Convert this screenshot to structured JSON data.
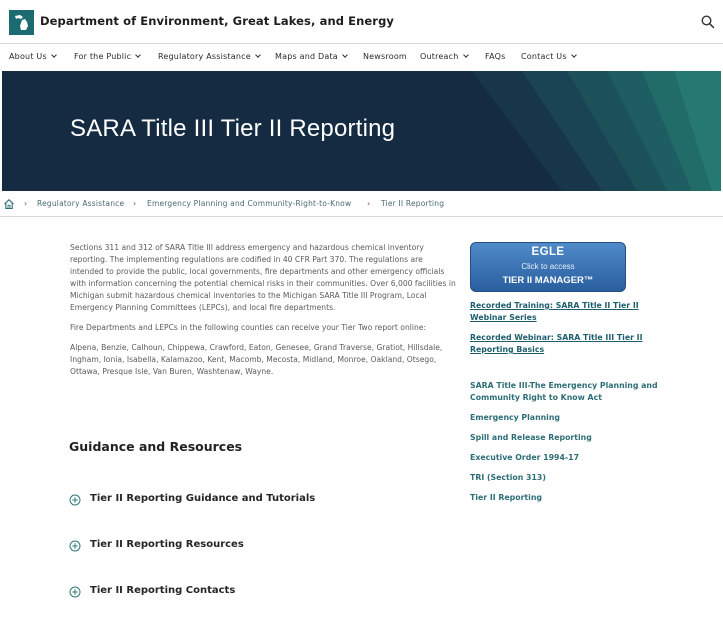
{
  "header": {
    "site_title": "Department of Environment, Great Lakes, and Energy",
    "logo_icon": "michigan-state-icon",
    "search_icon": "search-icon"
  },
  "nav": {
    "items": [
      {
        "label": "About Us",
        "has_dropdown": true
      },
      {
        "label": "For the Public",
        "has_dropdown": true
      },
      {
        "label": "Regulatory Assistance",
        "has_dropdown": true
      },
      {
        "label": "Maps and Data",
        "has_dropdown": true
      },
      {
        "label": "Newsroom",
        "has_dropdown": false
      },
      {
        "label": "Outreach",
        "has_dropdown": true
      },
      {
        "label": "FAQs",
        "has_dropdown": false
      },
      {
        "label": "Contact Us",
        "has_dropdown": true
      }
    ]
  },
  "hero": {
    "title": "SARA Title III Tier II Reporting"
  },
  "breadcrumb": {
    "home_icon": "home-icon",
    "items": [
      "Regulatory Assistance",
      "Emergency Planning and Community-Right-to-Know",
      "Tier II Reporting"
    ]
  },
  "main": {
    "paragraphs": [
      "Sections 311 and 312 of SARA Title III address emergency and hazardous chemical inventory reporting. The implementing regulations are codified in 40 CFR Part 370. The regulations are intended to provide the public, local governments, fire departments and other emergency officials with information concerning the potential chemical risks in their communities. Over 6,000 facilities in Michigan submit hazardous chemical inventories to the Michigan SARA Title III Program, Local Emergency Planning Committees (LEPCs), and local fire departments.",
      "Fire Departments and LEPCs in the following counties can receive your Tier Two report online:",
      "Alpena, Benzie, Calhoun, Chippewa, Crawford, Eaton, Genesee, Grand Traverse, Gratiot, Hillsdale, Ingham, Ionia, Isabella, Kalamazoo, Kent, Macomb, Mecosta, Midland, Monroe, Oakland, Otsego, Ottawa, Presque Isle, Van Buren, Washtenaw, Wayne."
    ],
    "section_title": "Guidance and Resources",
    "accordions": [
      {
        "label": "Tier II Reporting Guidance and Tutorials"
      },
      {
        "label": "Tier II Reporting Resources"
      },
      {
        "label": "Tier II Reporting Contacts"
      }
    ]
  },
  "sidebar": {
    "egle_button": {
      "line1": "EGLE",
      "line2": "Click to access",
      "line3": "TIER II MANAGER™"
    },
    "links": [
      "Recorded Training: SARA Title II Tier II Webinar Series",
      "Recorded Webinar: SARA Title III Tier II Reporting Basics"
    ],
    "related": [
      "SARA Title III-The Emergency Planning and Community Right to Know Act",
      "Emergency Planning",
      "Spill and Release Reporting",
      "Executive Order 1994-17",
      "TRI (Section 313)",
      "Tier II Reporting"
    ]
  },
  "colors": {
    "brand_teal": "#1b6b70",
    "hero_dark": "#142b41",
    "link_teal": "#1e5f6d",
    "button_blue": "#3b73b5"
  }
}
